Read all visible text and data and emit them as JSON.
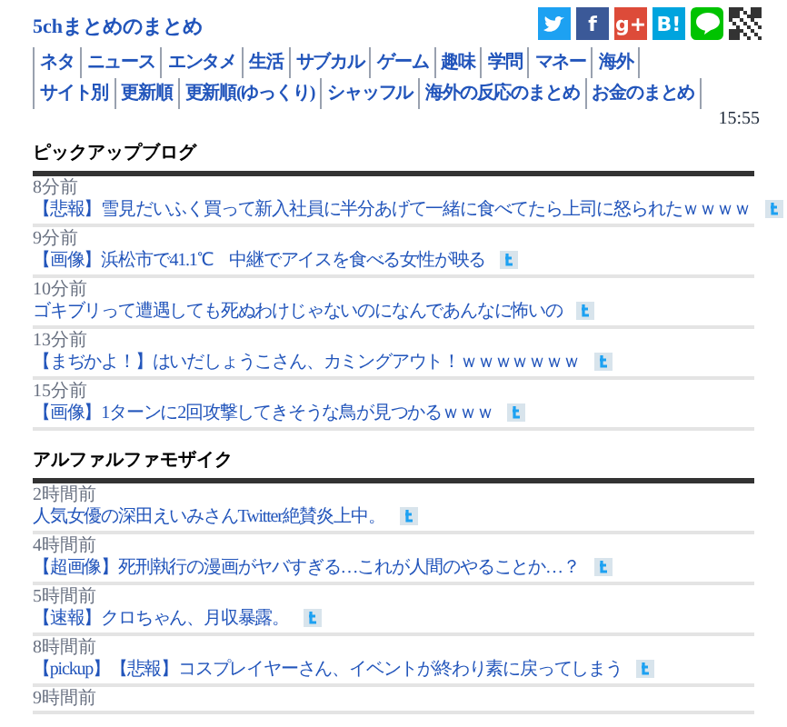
{
  "site_title": "5chまとめのまとめ",
  "share_buttons": [
    {
      "kind": "twitter",
      "color": "#1da1f2"
    },
    {
      "kind": "facebook",
      "color": "#3b5998",
      "label": "f"
    },
    {
      "kind": "googleplus",
      "color": "#dd4b39",
      "label": "g+"
    },
    {
      "kind": "hatena",
      "color": "#00a4de",
      "label": "B!"
    },
    {
      "kind": "line",
      "color": "#00c300"
    },
    {
      "kind": "qr",
      "color": "#333333"
    }
  ],
  "nav_rows": [
    [
      "ネタ",
      "ニュース",
      "エンタメ",
      "生活",
      "サブカル",
      "ゲーム",
      "趣味",
      "学問",
      "マネー",
      "海外"
    ],
    [
      "サイト別",
      "更新順",
      "更新順(ゆっくり)",
      "シャッフル",
      "海外の反応のまとめ",
      "お金のまとめ"
    ]
  ],
  "clock": "15:55",
  "sections": [
    {
      "title": "ピックアップブログ",
      "items": [
        {
          "time": "8分前",
          "title": "【悲報】雪見だいふく買って新入社員に半分あげて一緒に食べてたら上司に怒られたｗｗｗｗ"
        },
        {
          "time": "9分前",
          "title": "【画像】浜松市で41.1℃　中継でアイスを食べる女性が映る"
        },
        {
          "time": "10分前",
          "title": "ゴキブリって遭遇しても死ぬわけじゃないのになんであんなに怖いの"
        },
        {
          "time": "13分前",
          "title": "【まぢかよ！】はいだしょうこさん、カミングアウト！ｗｗｗｗｗｗｗ"
        },
        {
          "time": "15分前",
          "title": "【画像】1ターンに2回攻撃してきそうな鳥が見つかるｗｗｗ"
        }
      ]
    },
    {
      "title": "アルファルファモザイク",
      "items": [
        {
          "time": "2時間前",
          "title": "人気女優の深田えいみさんTwitter絶賛炎上中。"
        },
        {
          "time": "4時間前",
          "title": "【超画像】死刑執行の漫画がヤバすぎる…これが人間のやることか…？"
        },
        {
          "time": "5時間前",
          "title": "【速報】クロちゃん、月収暴露。"
        },
        {
          "time": "8時間前",
          "title": "【pickup】【悲報】コスプレイヤーさん、イベントが終わり素に戻ってしまう"
        },
        {
          "time": "9時間前"
        }
      ]
    }
  ]
}
